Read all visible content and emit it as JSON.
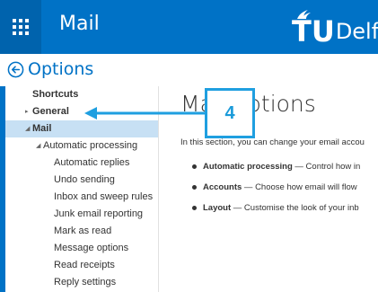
{
  "header": {
    "app_title": "Mail",
    "logo_mark": "TU",
    "logo_text": "Delft",
    "bar_color": "#0072c6",
    "icons": [
      "app-launcher-icon",
      "tu-delft-flame-icon"
    ]
  },
  "options": {
    "label": "Options",
    "back_icon": "back-arrow-circle-icon"
  },
  "sidebar": {
    "items": [
      {
        "label": "Shortcuts",
        "indent": 0,
        "bold": true,
        "triangle": ""
      },
      {
        "label": "General",
        "indent": 0,
        "bold": true,
        "triangle": "▸"
      },
      {
        "label": "Mail",
        "indent": 0,
        "bold": true,
        "triangle": "◢",
        "selected": true
      },
      {
        "label": "Automatic processing",
        "indent": 1,
        "bold": false,
        "triangle": "◢"
      },
      {
        "label": "Automatic replies",
        "indent": 2,
        "bold": false,
        "triangle": ""
      },
      {
        "label": "Undo sending",
        "indent": 2,
        "bold": false,
        "triangle": ""
      },
      {
        "label": "Inbox and sweep rules",
        "indent": 2,
        "bold": false,
        "triangle": ""
      },
      {
        "label": "Junk email reporting",
        "indent": 2,
        "bold": false,
        "triangle": ""
      },
      {
        "label": "Mark as read",
        "indent": 2,
        "bold": false,
        "triangle": ""
      },
      {
        "label": "Message options",
        "indent": 2,
        "bold": false,
        "triangle": ""
      },
      {
        "label": "Read receipts",
        "indent": 2,
        "bold": false,
        "triangle": ""
      },
      {
        "label": "Reply settings",
        "indent": 2,
        "bold": false,
        "triangle": ""
      }
    ]
  },
  "main": {
    "title": "Mail options",
    "intro": "In this section, you can change your email accou",
    "bullets": [
      {
        "term": "Automatic processing",
        "desc": " — Control how in"
      },
      {
        "term": "Accounts",
        "desc": " — Choose how email will flow"
      },
      {
        "term": "Layout",
        "desc": " — Customise the look of your inb"
      }
    ]
  },
  "annotation": {
    "step_number": "4",
    "color": "#1f9fe0"
  }
}
